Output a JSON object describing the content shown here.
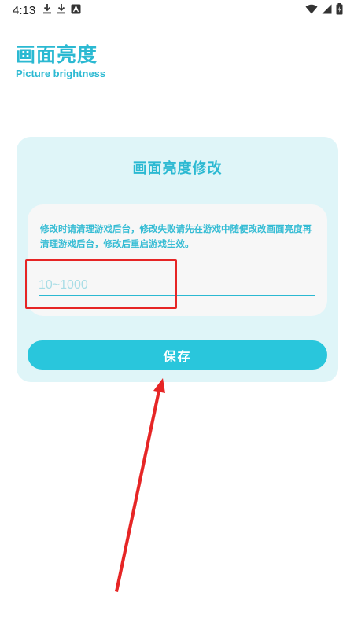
{
  "status_bar": {
    "time": "4:13",
    "left_icons": [
      "download-icon",
      "download-icon",
      "app-notification-icon"
    ],
    "right_icons": [
      "wifi-icon",
      "signal-icon",
      "battery-icon"
    ]
  },
  "header": {
    "title": "画面亮度",
    "subtitle": "Picture brightness"
  },
  "card": {
    "title": "画面亮度修改",
    "notice": "修改时请清理游戏后台，修改失败请先在游戏中随便改改画面亮度再清理游戏后台，修改后重启游戏生效。",
    "input": {
      "value": "",
      "placeholder": "10~1000"
    },
    "save_label": "保存"
  },
  "colors": {
    "accent": "#2bb9d2",
    "button": "#29c6dc",
    "card_bg": "#dff5f8",
    "annotation": "#e62525"
  }
}
